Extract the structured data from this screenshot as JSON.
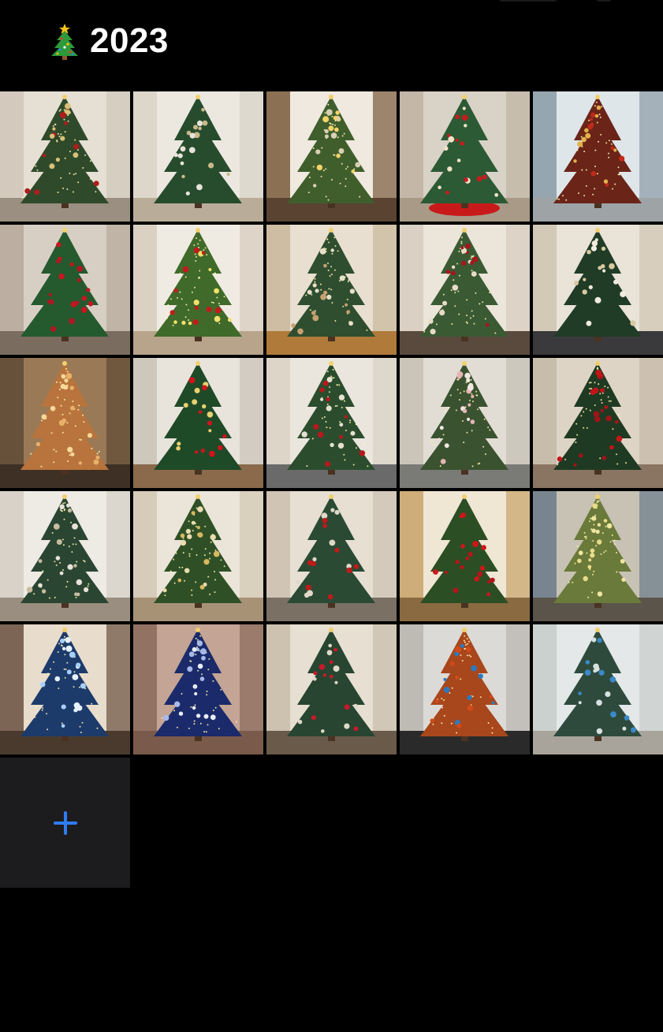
{
  "header": {
    "icon": "christmas-tree-icon",
    "title": "2023"
  },
  "add_button": {
    "icon": "plus-icon",
    "color": "#2f7df6"
  },
  "photos": [
    {
      "name": "photo-1",
      "bg": "#cfc6b8",
      "wall": "#e6e0d4",
      "floor": "#9a8f80",
      "tree": "#2f4a2a",
      "orn": [
        "#b01c1c",
        "#d8c07a"
      ],
      "lights": true
    },
    {
      "name": "photo-2",
      "bg": "#d9d3c6",
      "wall": "#ece8e0",
      "floor": "#b9ad99",
      "tree": "#274c2d",
      "orn": [
        "#e8e4da",
        "#c9b98a"
      ],
      "lights": false
    },
    {
      "name": "photo-3",
      "bg": "#7a5a3c",
      "wall": "#efe9df",
      "floor": "#5a4330",
      "tree": "#3f5e2c",
      "orn": [
        "#f4d36a",
        "#d9d0b4"
      ],
      "lights": true
    },
    {
      "name": "photo-4",
      "bg": "#bfb3a2",
      "wall": "#d9d2c6",
      "floor": "#a89a86",
      "tree": "#2c5a35",
      "orn": [
        "#c41e1e",
        "#f0e3c8"
      ],
      "lights": false,
      "skirt": "#c81a1a"
    },
    {
      "name": "photo-5",
      "bg": "#8a9aa6",
      "wall": "#dfe6ea",
      "floor": "#9ea4a6",
      "tree": "#6a2418",
      "orn": [
        "#c02a1a",
        "#e0b24a"
      ],
      "lights": true
    },
    {
      "name": "photo-6",
      "bg": "#b7a89a",
      "wall": "#d8cfc4",
      "floor": "#7a6c5e",
      "tree": "#245a2e",
      "orn": [
        "#c8161e",
        "#b01824"
      ],
      "lights": false
    },
    {
      "name": "photo-7",
      "bg": "#d6ccbd",
      "wall": "#f0ebe2",
      "floor": "#b8a48a",
      "tree": "#3f6a2a",
      "orn": [
        "#c31b1b",
        "#f2e06a"
      ],
      "lights": true
    },
    {
      "name": "photo-8",
      "bg": "#c9b79b",
      "wall": "#e8dfd0",
      "floor": "#b07a3a",
      "tree": "#2f4e30",
      "orn": [
        "#e8e0c8",
        "#c9a070"
      ],
      "lights": true
    },
    {
      "name": "photo-9",
      "bg": "#d7cdbf",
      "wall": "#ece5d9",
      "floor": "#5a4a3e",
      "tree": "#3a5a34",
      "orn": [
        "#a8161c",
        "#e8dcc8"
      ],
      "lights": true
    },
    {
      "name": "photo-10",
      "bg": "#cfc4b2",
      "wall": "#e9e3d8",
      "floor": "#3a3a3c",
      "tree": "#203c26",
      "orn": [
        "#f2ecde",
        "#d8c9a0"
      ],
      "lights": false
    },
    {
      "name": "photo-11",
      "bg": "#5e4a36",
      "wall": "#9a7a56",
      "floor": "#3e3024",
      "tree": "#b8743c",
      "orn": [
        "#e8b06a",
        "#f6d898"
      ],
      "lights": true
    },
    {
      "name": "photo-12",
      "bg": "#c9c2b6",
      "wall": "#e8e4dc",
      "floor": "#8a6a4a",
      "tree": "#1f4a28",
      "orn": [
        "#d0141c",
        "#e8d070"
      ],
      "lights": false
    },
    {
      "name": "photo-13",
      "bg": "#d9d1c4",
      "wall": "#ebe6dd",
      "floor": "#6a6a6a",
      "tree": "#2b4d2e",
      "orn": [
        "#b8181c",
        "#e6e0d0"
      ],
      "lights": true
    },
    {
      "name": "photo-14",
      "bg": "#c5bfb4",
      "wall": "#e2ddd4",
      "floor": "#7a7a76",
      "tree": "#3a5230",
      "orn": [
        "#e4b4b4",
        "#f0e8e0"
      ],
      "lights": true
    },
    {
      "name": "photo-15",
      "bg": "#c4b8a6",
      "wall": "#ded4c6",
      "floor": "#8a7462",
      "tree": "#1f3a22",
      "orn": [
        "#c41418",
        "#a01418"
      ],
      "lights": true
    },
    {
      "name": "photo-16",
      "bg": "#d4cec4",
      "wall": "#eeeae4",
      "floor": "#9a8e80",
      "tree": "#2a4632",
      "orn": [
        "#e8e2d6",
        "#c8bca0"
      ],
      "lights": true
    },
    {
      "name": "photo-17",
      "bg": "#d3c7b4",
      "wall": "#ebe4d8",
      "floor": "#a89276",
      "tree": "#2f5026",
      "orn": [
        "#d8b860",
        "#eadcb0"
      ],
      "lights": true
    },
    {
      "name": "photo-18",
      "bg": "#cbc0b0",
      "wall": "#e6dfd2",
      "floor": "#7a7064",
      "tree": "#2a4a34",
      "orn": [
        "#c01a1a",
        "#e0d8c8"
      ],
      "lights": false
    },
    {
      "name": "photo-19",
      "bg": "#c9a26a",
      "wall": "#efe6d4",
      "floor": "#8a6a40",
      "tree": "#2c4e24",
      "orn": [
        "#d0161a",
        "#b8141a"
      ],
      "lights": false
    },
    {
      "name": "photo-20",
      "bg": "#6a7a8a",
      "wall": "#c8c2b4",
      "floor": "#5a544a",
      "tree": "#6a7a3a",
      "orn": [
        "#f0e6a0",
        "#e8dc8a"
      ],
      "lights": true
    },
    {
      "name": "photo-21",
      "bg": "#6a5040",
      "wall": "#e8dccc",
      "floor": "#4a3a2e",
      "tree": "#1c3a6a",
      "orn": [
        "#a8d0ff",
        "#e8f2ff"
      ],
      "lights": true
    },
    {
      "name": "photo-22",
      "bg": "#8a6a5a",
      "wall": "#c4a494",
      "floor": "#7a5a4a",
      "tree": "#1a2a6a",
      "orn": [
        "#e8ecf4",
        "#a8b8e8"
      ],
      "lights": true
    },
    {
      "name": "photo-23",
      "bg": "#c8bcaa",
      "wall": "#e6dfd2",
      "floor": "#6a5a4a",
      "tree": "#274530",
      "orn": [
        "#e0d8c8",
        "#c81a2a"
      ],
      "lights": false
    },
    {
      "name": "photo-24",
      "bg": "#b8b4ae",
      "wall": "#dcdad6",
      "floor": "#2a2a2a",
      "tree": "#a8461c",
      "orn": [
        "#2a7ac0",
        "#d04a1a"
      ],
      "lights": true
    },
    {
      "name": "photo-25",
      "bg": "#c7ccca",
      "wall": "#e4e8e8",
      "floor": "#a8a49c",
      "tree": "#2e4a3c",
      "orn": [
        "#3a8ac8",
        "#d8e0e0"
      ],
      "lights": false
    }
  ]
}
